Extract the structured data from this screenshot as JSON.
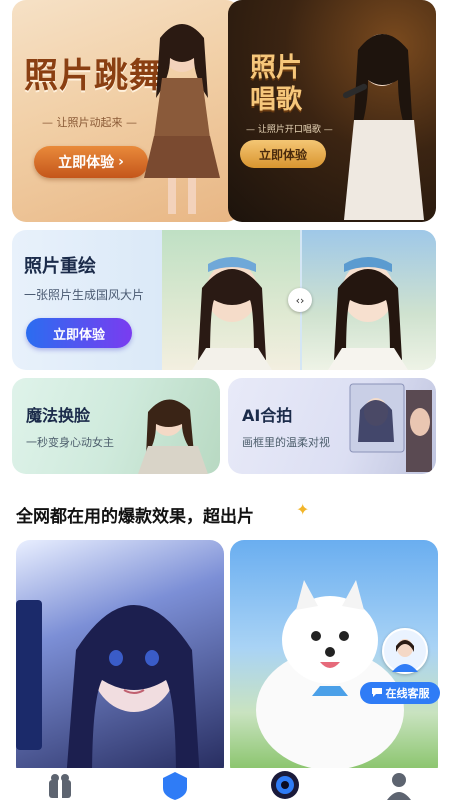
{
  "features": {
    "dance": {
      "title": "照片跳舞",
      "subtitle": "— 让照片动起来 —",
      "button": "立即体验",
      "chevron": "›"
    },
    "sing": {
      "title_line1": "照片",
      "title_line2": "唱歌",
      "subtitle": "— 让照片开口唱歌 —",
      "button": "立即体验"
    },
    "redraw": {
      "title": "照片重绘",
      "subtitle": "一张照片生成国风大片",
      "button": "立即体验",
      "compare_icon": "‹›"
    },
    "faceswap": {
      "title": "魔法换脸",
      "subtitle": "一秒变身心动女主"
    },
    "aiphoto": {
      "title": "AI合拍",
      "subtitle": "画框里的温柔对视"
    }
  },
  "section": {
    "title": "全网都在用的爆款效果，超出片",
    "icon": "sparkle-icon"
  },
  "service": {
    "label": "在线客服",
    "icon": "chat-bubble-icon"
  },
  "nav": [
    {
      "icon": "gift-icon"
    },
    {
      "icon": "shield-home-icon"
    },
    {
      "icon": "camera-lens-icon"
    },
    {
      "icon": "user-icon"
    }
  ],
  "colors": {
    "accent_blue": "#2f7cf6",
    "orange_button": "#d9702a",
    "gold_button": "#e6aa4a",
    "purple_gradient_end": "#7a3cf0"
  }
}
